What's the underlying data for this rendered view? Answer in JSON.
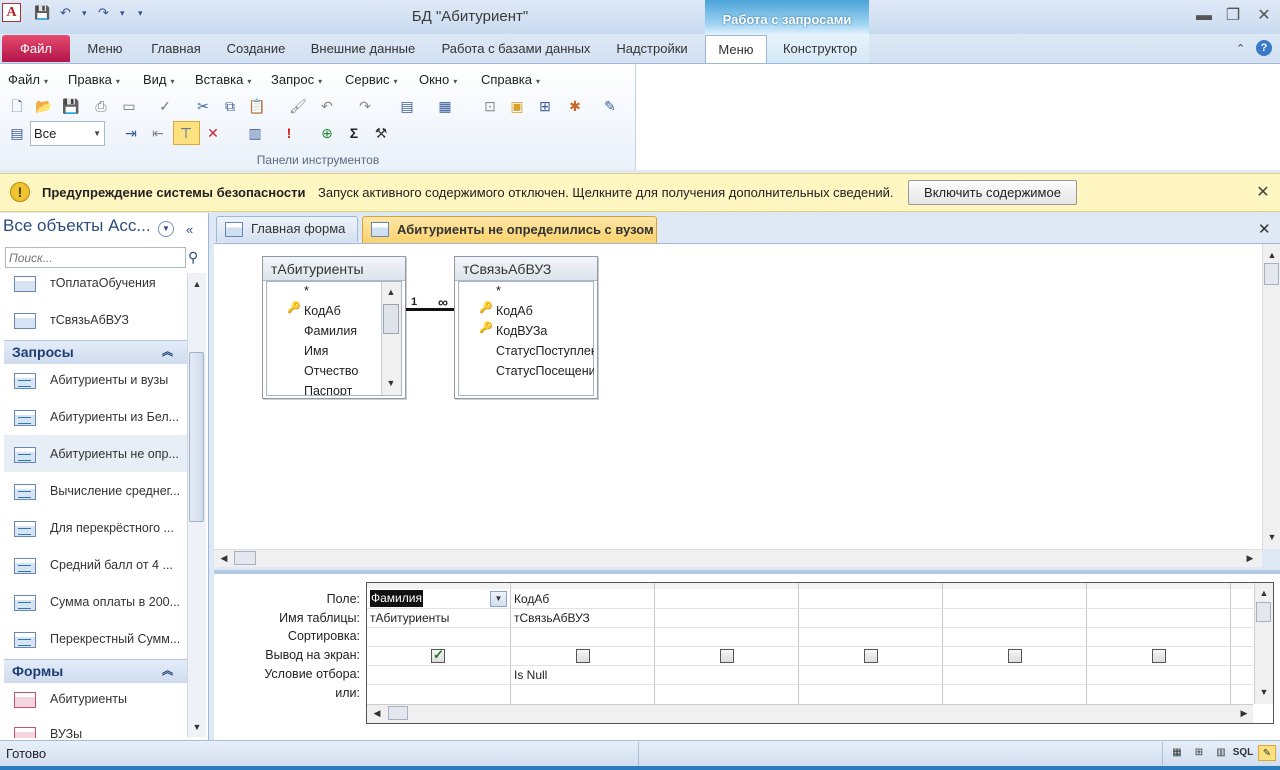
{
  "window": {
    "title": "БД \"Абитуриент\"",
    "context_tab_group": "Работа с запросами",
    "qat": [
      "💾",
      "↶",
      "▾",
      "↷",
      "▾",
      "▾"
    ]
  },
  "ribbon": {
    "tabs": [
      "Файл",
      "Меню",
      "Главная",
      "Создание",
      "Внешние данные",
      "Работа с базами данных",
      "Надстройки",
      "Меню",
      "Конструктор"
    ],
    "menu": [
      "Файл",
      "Правка",
      "Вид",
      "Вставка",
      "Запрос",
      "Сервис",
      "Окно",
      "Справка"
    ],
    "combo_value": "Все",
    "group_label": "Панели инструментов",
    "sigma": "Σ",
    "exclaim": "!"
  },
  "security": {
    "title": "Предупреждение системы безопасности",
    "message": "Запуск активного содержимого отключен. Щелкните для получения дополнительных сведений.",
    "button": "Включить содержимое"
  },
  "nav": {
    "header": "Все объекты Acc...",
    "search_placeholder": "Поиск...",
    "tables": [
      "тОплатаОбучения",
      "тСвязьАбВУЗ"
    ],
    "queries_group": "Запросы",
    "queries": [
      "Абитуриенты и вузы",
      "Абитуриенты из Бел...",
      "Абитуриенты не опр...",
      "Вычисление среднег...",
      "Для перекрёстного ...",
      "Средний балл от 4 ...",
      "Сумма оплаты в 200...",
      "Перекрестный Сумм..."
    ],
    "forms_group": "Формы",
    "forms": [
      "Абитуриенты",
      "ВУЗы"
    ]
  },
  "doc_tabs": [
    "Главная форма",
    "Абитуриенты не определились с вузом"
  ],
  "design": {
    "table1": {
      "name": "тАбитуриенты",
      "fields": [
        "*",
        "КодАб",
        "Фамилия",
        "Имя",
        "Отчество",
        "Паспорт"
      ],
      "key_fields": [
        1
      ]
    },
    "table2": {
      "name": "тСвязьАбВУЗ",
      "fields": [
        "*",
        "КодАб",
        "КодВУЗа",
        "СтатусПоступлен",
        "СтатусПосещени"
      ],
      "key_fields": [
        1,
        2
      ]
    },
    "relation": {
      "one": "1",
      "many": "∞"
    }
  },
  "grid": {
    "row_labels": [
      "Поле:",
      "Имя таблицы:",
      "Сортировка:",
      "Вывод на экран:",
      "Условие отбора:",
      "или:"
    ],
    "columns": [
      {
        "field": "Фамилия",
        "table": "тАбитуриенты",
        "show": true,
        "criteria": ""
      },
      {
        "field": "КодАб",
        "table": "тСвязьАбВУЗ",
        "show": false,
        "criteria": "Is Null"
      },
      {
        "field": "",
        "table": "",
        "show": false,
        "criteria": ""
      },
      {
        "field": "",
        "table": "",
        "show": false,
        "criteria": ""
      },
      {
        "field": "",
        "table": "",
        "show": false,
        "criteria": ""
      },
      {
        "field": "",
        "table": "",
        "show": false,
        "criteria": ""
      }
    ]
  },
  "status": {
    "text": "Готово",
    "sql": "SQL"
  }
}
